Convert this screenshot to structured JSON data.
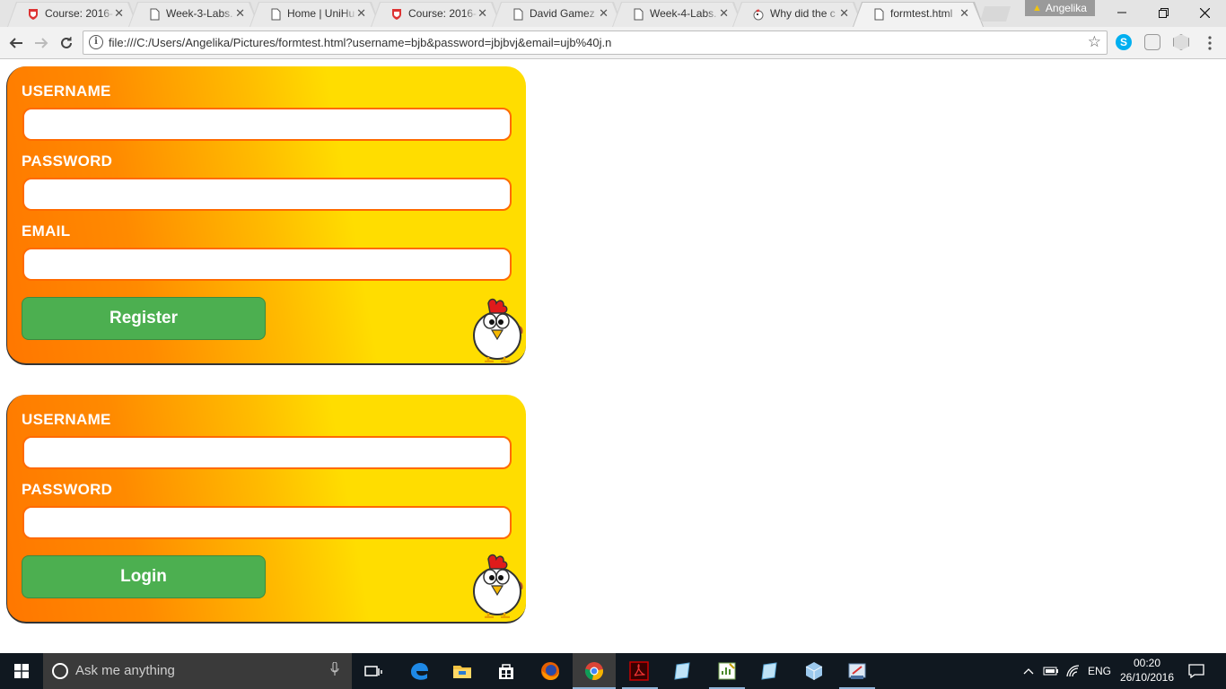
{
  "browser": {
    "tabs": [
      {
        "title": "Course: 2016-",
        "icon": "shield-favicon"
      },
      {
        "title": "Week-3-Labs.",
        "icon": "document-favicon"
      },
      {
        "title": "Home | UniHu",
        "icon": "document-favicon"
      },
      {
        "title": "Course: 2016-",
        "icon": "shield-favicon"
      },
      {
        "title": "David Gamez",
        "icon": "document-favicon"
      },
      {
        "title": "Week-4-Labs.",
        "icon": "document-favicon"
      },
      {
        "title": "Why did the c",
        "icon": "chicken-favicon"
      },
      {
        "title": "formtest.html",
        "icon": "document-favicon",
        "active": true
      }
    ],
    "profile_name": "Angelika",
    "url": "file:///C:/Users/Angelika/Pictures/formtest.html?username=bjb&password=jbjbvj&email=ujb%40j.n"
  },
  "register_form": {
    "username_label": "USERNAME",
    "password_label": "PASSWORD",
    "email_label": "EMAIL",
    "username_value": "",
    "password_value": "",
    "email_value": "",
    "submit_label": "Register"
  },
  "login_form": {
    "username_label": "USERNAME",
    "password_label": "PASSWORD",
    "username_value": "",
    "password_value": "",
    "submit_label": "Login"
  },
  "taskbar": {
    "search_placeholder": "Ask me anything",
    "language": "ENG",
    "time": "00:20",
    "date": "26/10/2016"
  },
  "colors": {
    "form_gradient_start": "#ff7700",
    "form_gradient_end": "#ffdd00",
    "field_border": "#ff6a00",
    "button_green": "#4caf50"
  }
}
